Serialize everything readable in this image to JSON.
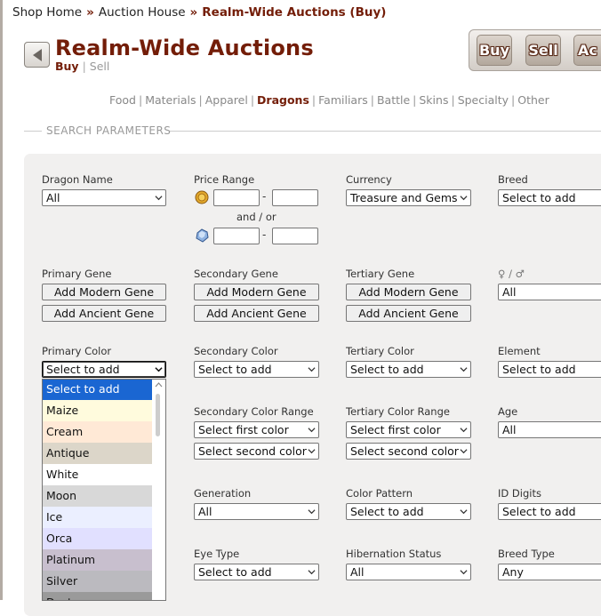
{
  "breadcrumb": {
    "items": [
      "Shop Home",
      "Auction House",
      "Realm-Wide Auctions (Buy)"
    ],
    "separator": "»"
  },
  "header": {
    "title": "Realm-Wide Auctions",
    "subnav": {
      "buy": "Buy",
      "sep": "|",
      "sell": "Sell"
    }
  },
  "top_buttons": {
    "buy": "Buy",
    "sell": "Sell",
    "auctions": "Ac"
  },
  "categories": [
    {
      "label": "Food",
      "active": false
    },
    {
      "label": "Materials",
      "active": false
    },
    {
      "label": "Apparel",
      "active": false
    },
    {
      "label": "Dragons",
      "active": true
    },
    {
      "label": "Familiars",
      "active": false
    },
    {
      "label": "Battle",
      "active": false
    },
    {
      "label": "Skins",
      "active": false
    },
    {
      "label": "Specialty",
      "active": false
    },
    {
      "label": "Other",
      "active": false
    }
  ],
  "section": {
    "legend": "SEARCH PARAMETERS"
  },
  "fields": {
    "dragon_name": {
      "label": "Dragon Name",
      "value": "All"
    },
    "price_range": {
      "label": "Price Range",
      "and_or": "and / or",
      "dash": "-"
    },
    "currency": {
      "label": "Currency",
      "value": "Treasure and Gems"
    },
    "breed": {
      "label": "Breed",
      "value": "Select to add"
    },
    "primary_gene": {
      "label": "Primary Gene",
      "modern": "Add Modern Gene",
      "ancient": "Add Ancient Gene"
    },
    "secondary_gene": {
      "label": "Secondary Gene",
      "modern": "Add Modern Gene",
      "ancient": "Add Ancient Gene"
    },
    "tertiary_gene": {
      "label": "Tertiary Gene",
      "modern": "Add Modern Gene",
      "ancient": "Add Ancient Gene"
    },
    "gender": {
      "label": "♀ / ♂",
      "value": "All"
    },
    "primary_color": {
      "label": "Primary Color",
      "value": "Select to add"
    },
    "secondary_color": {
      "label": "Secondary Color",
      "value": "Select to add"
    },
    "tertiary_color": {
      "label": "Tertiary Color",
      "value": "Select to add"
    },
    "element": {
      "label": "Element",
      "value": "Select to add"
    },
    "secondary_color_range": {
      "label": "Secondary Color Range",
      "first": "Select first color",
      "second": "Select second color"
    },
    "tertiary_color_range": {
      "label": "Tertiary Color Range",
      "first": "Select first color",
      "second": "Select second color"
    },
    "age": {
      "label": "Age",
      "value": "All"
    },
    "generation": {
      "label": "Generation",
      "value": "All"
    },
    "color_pattern": {
      "label": "Color Pattern",
      "value": "Select to add"
    },
    "id_digits": {
      "label": "ID Digits",
      "value": "Select to add"
    },
    "eye_type": {
      "label": "Eye Type",
      "value": "Select to add"
    },
    "hibernation_status": {
      "label": "Hibernation Status",
      "value": "All"
    },
    "breed_type": {
      "label": "Breed Type",
      "value": "Any"
    }
  },
  "color_options": [
    {
      "label": "Select to add",
      "color": "#1a66d2",
      "highlighted": true
    },
    {
      "label": "Maize",
      "color": "#fffbdd"
    },
    {
      "label": "Cream",
      "color": "#ffe9d6"
    },
    {
      "label": "Antique",
      "color": "#dcd6c9"
    },
    {
      "label": "White",
      "color": "#ffffff"
    },
    {
      "label": "Moon",
      "color": "#d8d8d8"
    },
    {
      "label": "Ice",
      "color": "#ebefff"
    },
    {
      "label": "Orca",
      "color": "#e1e0ff"
    },
    {
      "label": "Platinum",
      "color": "#c8bfce"
    },
    {
      "label": "Silver",
      "color": "#bbbabf"
    },
    {
      "label": "Dust",
      "color": "#9a9a9a"
    }
  ],
  "colors": {
    "accent": "#731d08",
    "panel": "#f1f0ef",
    "highlight": "#1a66d2"
  }
}
